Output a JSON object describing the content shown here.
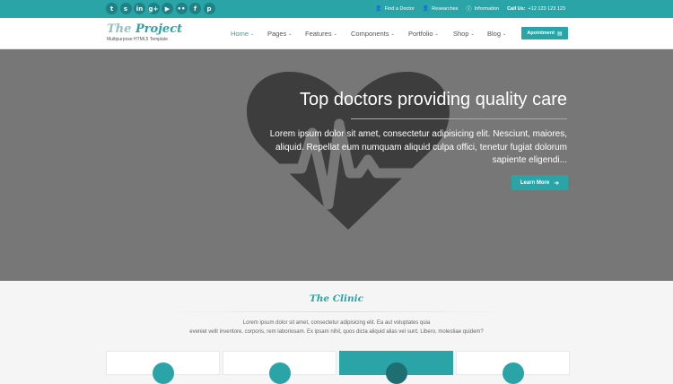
{
  "topbar": {
    "socials": [
      {
        "icon": "twitter-icon",
        "glyph": "t"
      },
      {
        "icon": "skype-icon",
        "glyph": "s"
      },
      {
        "icon": "linkedin-icon",
        "glyph": "in"
      },
      {
        "icon": "googleplus-icon",
        "glyph": "g+"
      },
      {
        "icon": "youtube-icon",
        "glyph": "▶"
      },
      {
        "icon": "flickr-icon",
        "glyph": "••"
      },
      {
        "icon": "facebook-icon",
        "glyph": "f"
      },
      {
        "icon": "pinterest-icon",
        "glyph": "p"
      }
    ],
    "find_doctor": "Find a Doctor",
    "researches": "Researches",
    "information": "Information",
    "call_label": "Call Us:",
    "call_number": "+12 123 123 123"
  },
  "header": {
    "logo_the": "The",
    "logo_project": "Project",
    "tagline": "Multipurpose HTML5 Template",
    "nav": [
      {
        "label": "Home",
        "active": true
      },
      {
        "label": "Pages"
      },
      {
        "label": "Features"
      },
      {
        "label": "Components"
      },
      {
        "label": "Portfolio"
      },
      {
        "label": "Shop"
      },
      {
        "label": "Blog"
      }
    ],
    "appointment": "Apointment"
  },
  "hero": {
    "title": "Top doctors providing quality care",
    "text": "Lorem ipsum dolor sit amet, consectetur adipisicing elit. Nesciunt, maiores, aliquid. Repellat eum numquam aliquid culpa offici, tenetur fugiat dolorum sapiente eligendi...",
    "button": "Learn More"
  },
  "clinic": {
    "title": "The Clinic",
    "text_line1": "Lorem ipsum dolor sit amet, consectetur adipisicing elit. Ea aut voluptates quia",
    "text_line2": "eveniet velit inventore, corporis, rem laboriosam. Ex ipsam nihil, quos dicta aliquid alias vel sunt. Libero, molestiae quidem?"
  },
  "colors": {
    "accent": "#2ba4a8",
    "hero_bg": "#777777",
    "heart": "#3d3d3d"
  }
}
